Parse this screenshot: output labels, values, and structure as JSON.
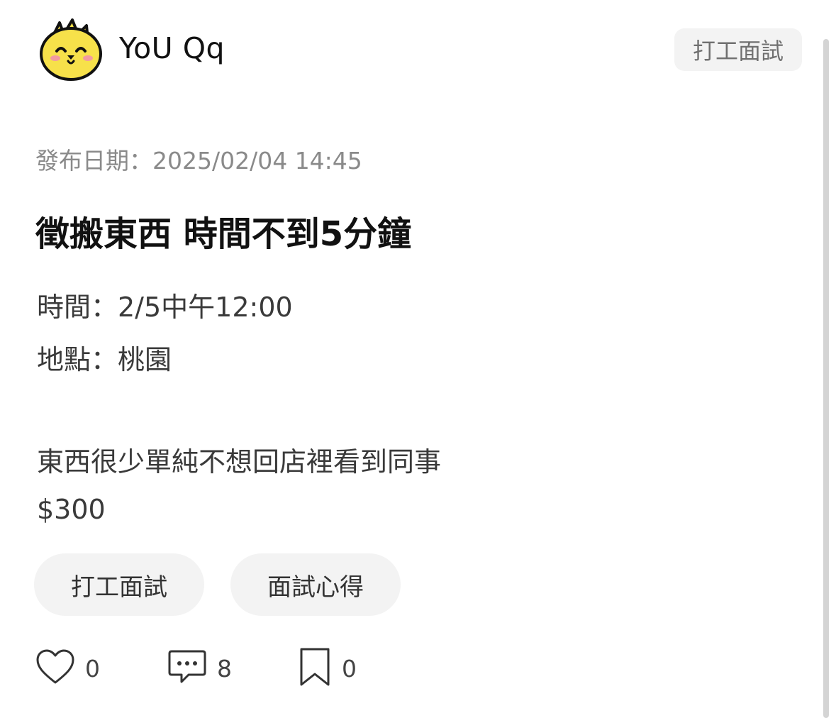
{
  "header": {
    "author_name": "YoU Qq",
    "board_badge": "打工面試"
  },
  "post": {
    "date": "發布日期：2025/02/04 14:45",
    "title": "徵搬東西 時間不到5分鐘",
    "lines": [
      "時間：2/5中午12:00",
      "地點：桃園",
      "東西很少單純不想回店裡看到同事",
      "$300"
    ],
    "tags": [
      "打工面試",
      "面試心得"
    ]
  },
  "actions": {
    "like_count": "0",
    "comment_count": "8",
    "save_count": "0"
  },
  "icons": {
    "avatar": "yellow-chick-avatar",
    "like": "heart-icon",
    "comment": "comment-bubble-icon",
    "save": "bookmark-icon"
  },
  "colors": {
    "avatar_yellow": "#f7e14a",
    "tag_background": "#f3f3f3",
    "secondary_text": "#8a8a8a"
  }
}
